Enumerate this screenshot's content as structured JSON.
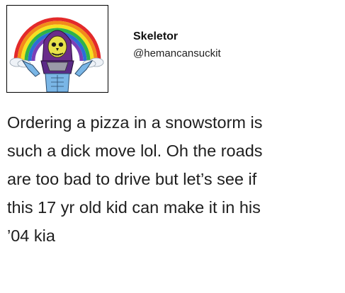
{
  "user": {
    "display_name": "Skeletor",
    "handle": "@hemancansuckit"
  },
  "avatar": {
    "icon": "skeletor-rainbow-avatar-icon"
  },
  "tweet": {
    "lines": [
      "Ordering a pizza in a snowstorm is",
      "such a dick move lol. Oh the roads",
      "are too bad to drive but let’s see if",
      "this 17 yr old kid can make it in his",
      "’04 kia"
    ]
  }
}
